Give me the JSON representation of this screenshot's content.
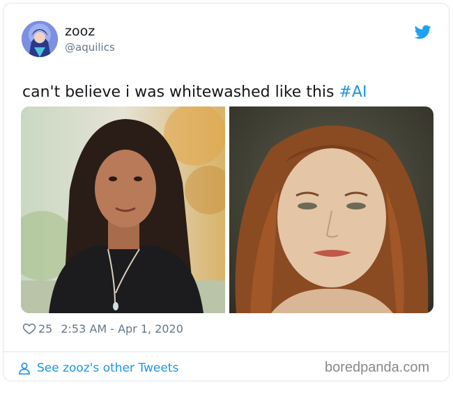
{
  "tweet": {
    "display_name": "zooz",
    "handle": "@aquilics",
    "text_prefix": "can't believe i was whitewashed like this ",
    "hashtag": "#AI",
    "likes": "25",
    "timestamp": "2:53 AM - Apr 1, 2020",
    "avatar_icon": "avatar",
    "brand_icon": "twitter-bird-icon",
    "accent_color": "#1b95e0"
  },
  "images": [
    {
      "name": "original-photo"
    },
    {
      "name": "ai-painting"
    }
  ],
  "footer": {
    "link_label": "See zooz's other Tweets",
    "link_icon": "person-icon"
  },
  "watermark": {
    "text": "boredpanda.com"
  }
}
